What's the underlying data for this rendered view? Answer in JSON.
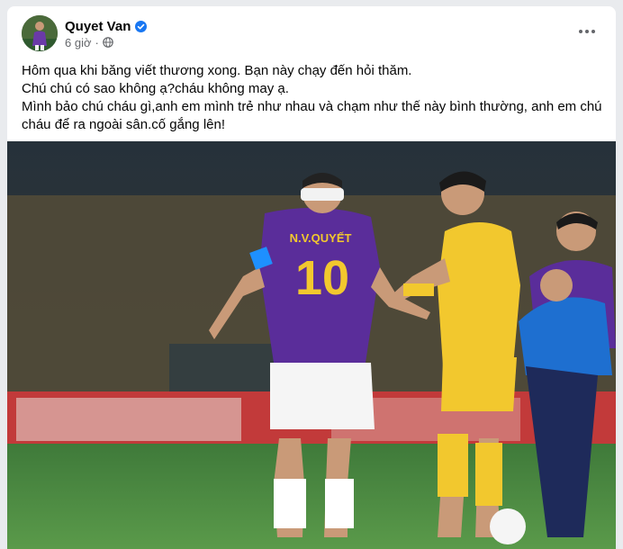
{
  "post": {
    "author": "Quyet Van",
    "time": "6 giờ",
    "lines": [
      "Hôm qua khi băng viết thương xong. Bạn này chạy đến hỏi thăm.",
      "Chú chú có sao không ạ?cháu không may ạ.",
      "Mình bảo chú cháu gì,anh em mình trẻ như nhau và chạm như thế này bình thường, anh em chú",
      "cháu để ra ngoài sân.cố gắng lên!"
    ]
  },
  "photo": {
    "left_shirt_name": "N.V.QUYẾT",
    "left_shirt_number": "10"
  },
  "icons": {
    "verified": "verified-badge-icon",
    "audience": "globe-icon",
    "menu": "more-options-icon"
  },
  "colors": {
    "verified_blue": "#1877f2",
    "hanoi_purple": "#5a2d9a",
    "opponent_yellow": "#f2c82e"
  }
}
